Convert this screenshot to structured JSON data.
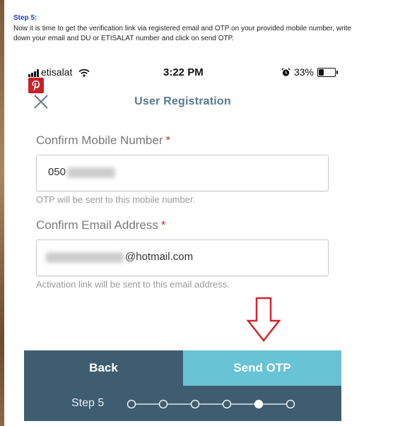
{
  "instructions": {
    "title": "Step 5:",
    "body": "Now it is time to get the verification link via registered email and OTP on your provided mobile number, write down your email and DU or ETISALAT number and click on send OTP."
  },
  "status_bar": {
    "carrier": "etisalat",
    "time": "3:22 PM",
    "battery": "33%",
    "battery_level": 0.33
  },
  "header": {
    "title": "User Registration"
  },
  "mobile_field": {
    "label": "Confirm Mobile Number",
    "required_mark": "*",
    "value_visible": "050",
    "hint": "OTP will be sent to this mobile number."
  },
  "email_field": {
    "label": "Confirm Email Address",
    "required_mark": "*",
    "value_visible": "@hotmail.com",
    "hint": "Activation link will be sent to this email address."
  },
  "buttons": {
    "back": "Back",
    "send_otp": "Send OTP"
  },
  "progress": {
    "label": "Step 5",
    "total_steps": 6,
    "current_step": 5
  },
  "colors": {
    "nav_dark": "#3f5d70",
    "accent_cyan": "#68c3d4",
    "arrow_red": "#d0262e",
    "pinterest_red": "#cb1f27"
  },
  "icons": {
    "signal": "signal-bars-icon",
    "wifi": "wifi-icon",
    "alarm": "alarm-clock-icon",
    "battery": "battery-icon",
    "close": "close-icon",
    "pinterest": "pinterest-icon",
    "arrow": "down-arrow-icon"
  }
}
